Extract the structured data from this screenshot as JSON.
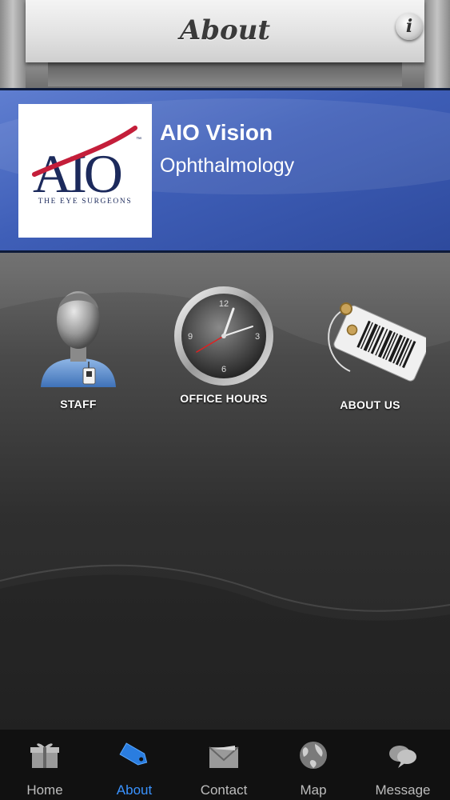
{
  "header": {
    "title": "About",
    "info_button_glyph": "i"
  },
  "banner": {
    "logo": {
      "letters": "AIO",
      "trademark": "™",
      "tagline": "THE EYE SURGEONS"
    },
    "company_name": "AIO Vision",
    "company_subtitle": "Ophthalmology"
  },
  "tiles": [
    {
      "label": "STAFF",
      "icon": "staff-person-icon"
    },
    {
      "label": "OFFICE HOURS",
      "icon": "clock-icon"
    },
    {
      "label": "ABOUT US",
      "icon": "barcode-tag-icon"
    }
  ],
  "clock_numbers": [
    "12",
    "3",
    "6",
    "9"
  ],
  "tabbar": {
    "active_index": 1,
    "active_color": "#3a93ff",
    "inactive_color": "#bdbdbd",
    "items": [
      {
        "label": "Home",
        "icon": "gift-box-icon"
      },
      {
        "label": "About",
        "icon": "tag-icon"
      },
      {
        "label": "Contact",
        "icon": "envelope-icon"
      },
      {
        "label": "Map",
        "icon": "globe-icon"
      },
      {
        "label": "Message",
        "icon": "chat-bubbles-icon"
      }
    ]
  }
}
